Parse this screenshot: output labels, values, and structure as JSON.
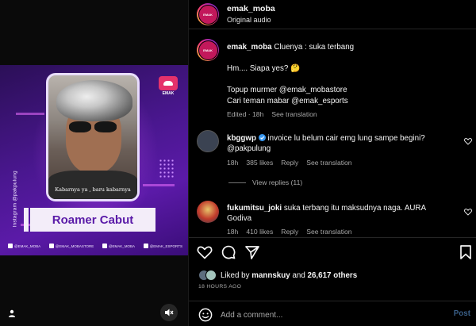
{
  "media": {
    "side_text": "Instagram @pakpulung",
    "caption": "Kabarnya ya , baru kabarnya",
    "brand_label": "EMAK",
    "title": "Roamer Cabut",
    "socials": [
      "@EMAK_MOBA",
      "@EMAK_MOBASTORE",
      "@EMAK_MOBA",
      "@EMAK_ESPORTS"
    ]
  },
  "header": {
    "username": "emak_moba",
    "audio": "Original audio"
  },
  "caption_post": {
    "username": "emak_moba",
    "lines": [
      "Cluenya : suka terbang",
      "Hm.... Siapa yes? 🤔",
      "Topup murmer @emak_mobastore",
      "Cari teman mabar @emak_esports"
    ],
    "edited": "Edited · 18h",
    "see_translation": "See translation"
  },
  "comments": [
    {
      "username": "kbggwp",
      "text_line1": "invoice lu belum cair emg lung sampe begini?",
      "text_line2": "@pakpulung",
      "time": "18h",
      "likes": "385 likes",
      "reply": "Reply",
      "see_translation": "See translation",
      "view_replies": "View replies (11)"
    },
    {
      "username": "fukumitsu_joki",
      "text_line1": "suka terbang itu maksudnya naga. AURA",
      "text_line2": "Godiva",
      "time": "18h",
      "likes": "410 likes",
      "reply": "Reply",
      "see_translation": "See translation"
    }
  ],
  "likes": {
    "prefix": "Liked by",
    "user": "mannskuy",
    "and": "and",
    "others": "26,617 others"
  },
  "time_ago": "18 HOURS AGO",
  "add_comment": {
    "placeholder": "Add a comment...",
    "post_label": "Post"
  },
  "colors": {
    "background": "#000000",
    "muted_text": "#a8a8a8",
    "post_button": "#3a5f87",
    "reel_purple": "#4a1790",
    "banner_text": "#5a1ba8"
  }
}
